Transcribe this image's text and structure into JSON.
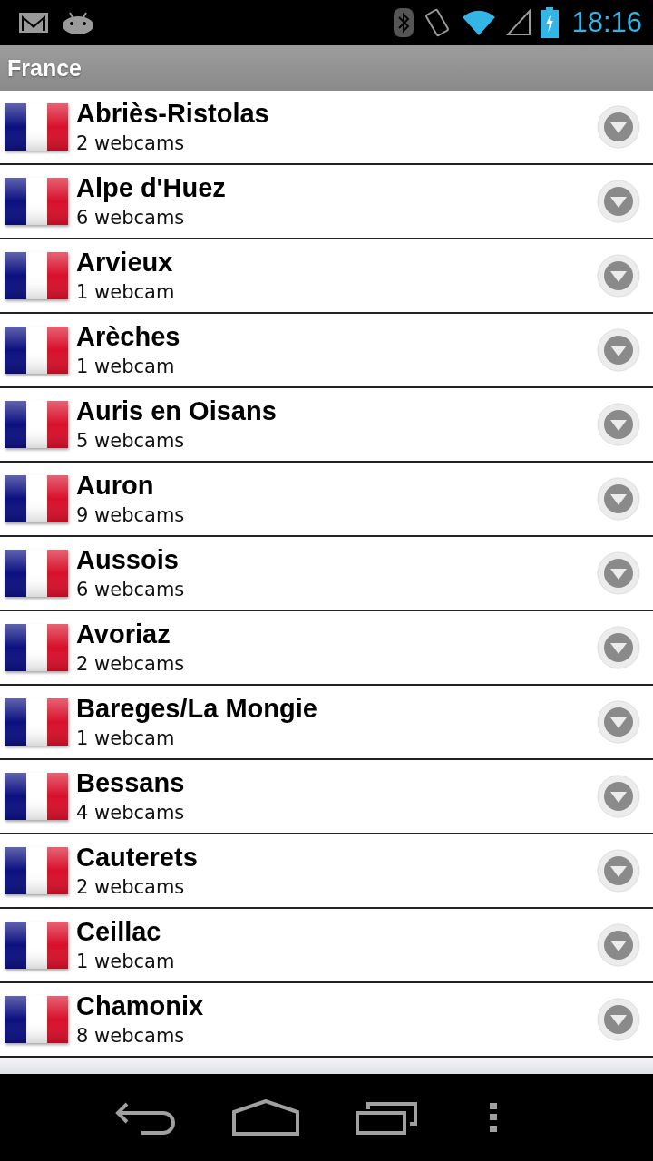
{
  "status_bar": {
    "time": "18:16"
  },
  "title": "France",
  "resorts": [
    {
      "name": "Abriès-Ristolas",
      "count": "2 webcams"
    },
    {
      "name": "Alpe d'Huez",
      "count": "6 webcams"
    },
    {
      "name": "Arvieux",
      "count": "1 webcam"
    },
    {
      "name": "Arèches",
      "count": "1 webcam"
    },
    {
      "name": "Auris en Oisans",
      "count": "5 webcams"
    },
    {
      "name": "Auron",
      "count": "9 webcams"
    },
    {
      "name": "Aussois",
      "count": "6 webcams"
    },
    {
      "name": "Avoriaz",
      "count": "2 webcams"
    },
    {
      "name": "Bareges/La Mongie",
      "count": "1 webcam"
    },
    {
      "name": "Bessans",
      "count": "4 webcams"
    },
    {
      "name": "Cauterets",
      "count": "2 webcams"
    },
    {
      "name": "Ceillac",
      "count": "1 webcam"
    },
    {
      "name": "Chamonix",
      "count": "8 webcams"
    }
  ]
}
